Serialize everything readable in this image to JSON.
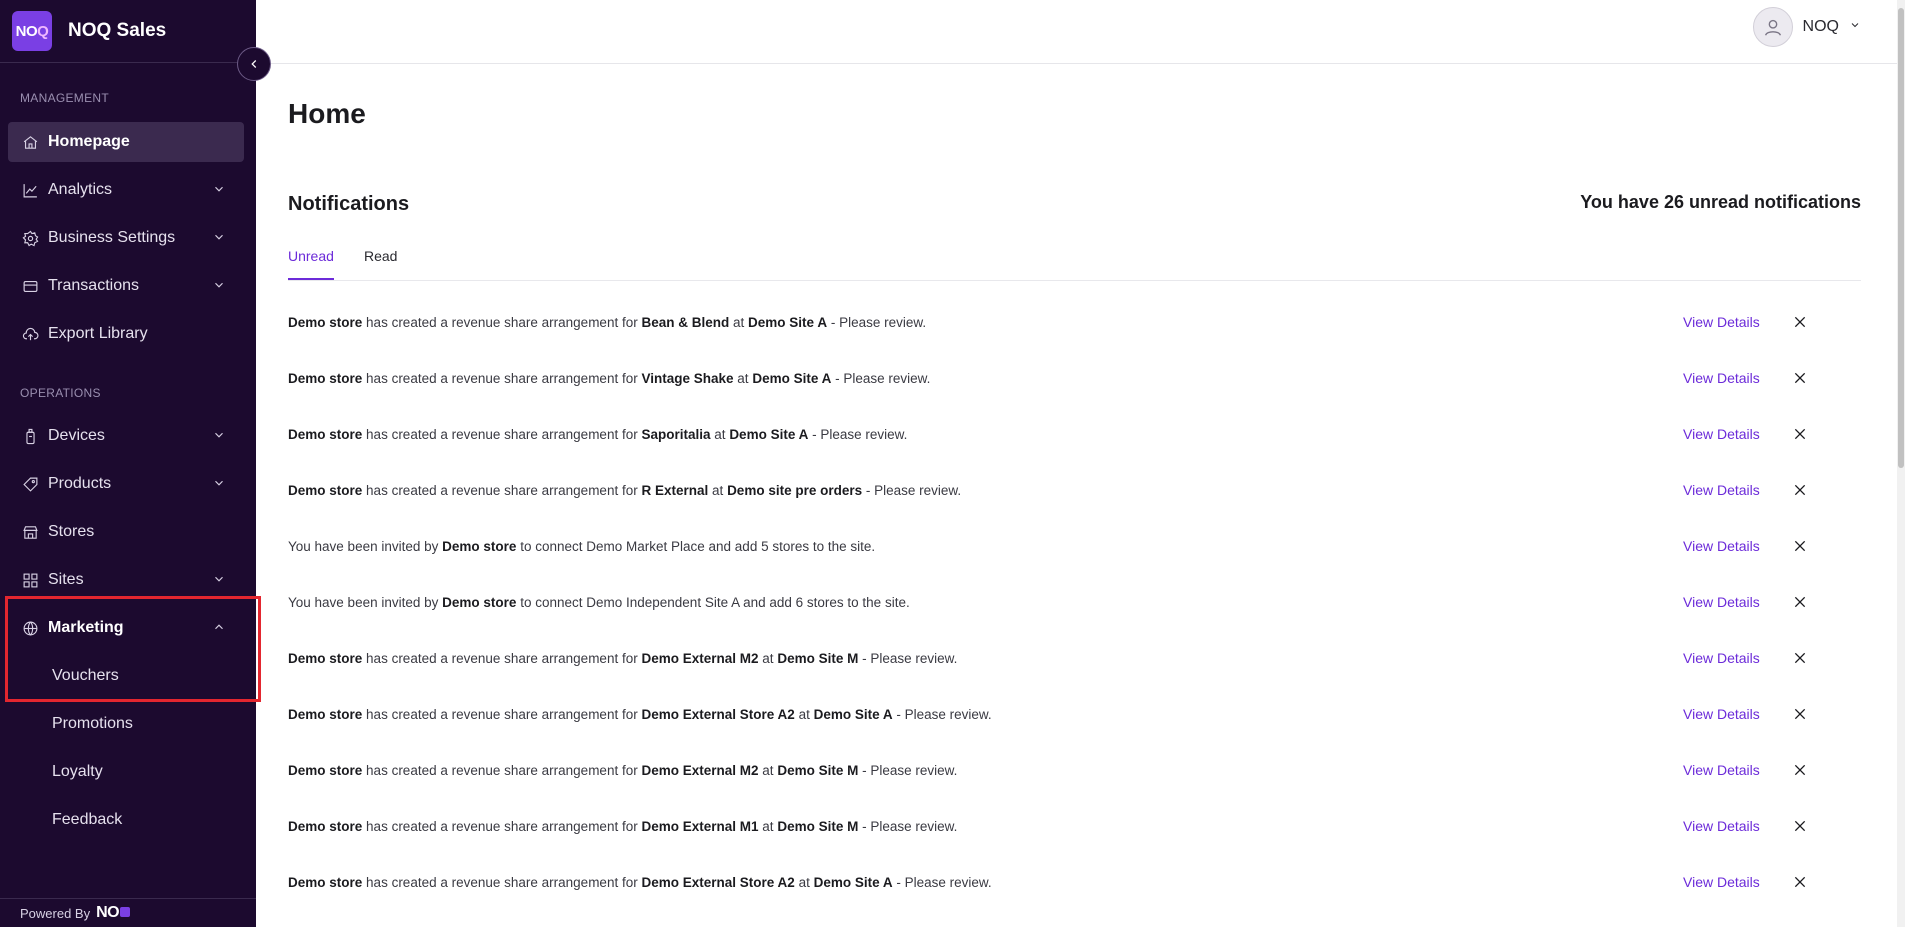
{
  "brand": {
    "name": "NOQ Sales",
    "logo_text_a": "NO",
    "logo_text_b": "Q"
  },
  "sidebar": {
    "management_label": "MANAGEMENT",
    "operations_label": "OPERATIONS",
    "items": [
      {
        "label": "Homepage",
        "icon": "home-icon"
      },
      {
        "label": "Analytics",
        "icon": "chart-icon"
      },
      {
        "label": "Business Settings",
        "icon": "gear-icon"
      },
      {
        "label": "Transactions",
        "icon": "card-icon"
      },
      {
        "label": "Export Library",
        "icon": "cloud-icon"
      },
      {
        "label": "Devices",
        "icon": "device-icon"
      },
      {
        "label": "Products",
        "icon": "tag-icon"
      },
      {
        "label": "Stores",
        "icon": "store-icon"
      },
      {
        "label": "Sites",
        "icon": "grid-icon"
      },
      {
        "label": "Marketing",
        "icon": "globe-icon"
      }
    ],
    "marketing_sub": [
      "Vouchers",
      "Promotions",
      "Loyalty",
      "Feedback"
    ],
    "powered_by": "Powered By",
    "powered_logo": "NO"
  },
  "topbar": {
    "user_name": "NOQ"
  },
  "main": {
    "title": "Home",
    "notifications_title": "Notifications",
    "unread_summary": "You have 26 unread notifications",
    "tabs": [
      "Unread",
      "Read"
    ],
    "view_details_label": "View Details",
    "notifications": [
      {
        "type": "revenue",
        "actor": "Demo store",
        "middle": "has created a revenue share arrangement for",
        "store": "Bean & Blend",
        "at": "at",
        "site": "Demo Site A",
        "suffix": "- Please review."
      },
      {
        "type": "revenue",
        "actor": "Demo store",
        "middle": "has created a revenue share arrangement for",
        "store": "Vintage Shake",
        "at": "at",
        "site": "Demo Site A",
        "suffix": "- Please review."
      },
      {
        "type": "revenue",
        "actor": "Demo store",
        "middle": "has created a revenue share arrangement for",
        "store": "Saporitalia",
        "at": "at",
        "site": "Demo Site A",
        "suffix": "- Please review."
      },
      {
        "type": "revenue",
        "actor": "Demo store",
        "middle": "has created a revenue share arrangement for",
        "store": "R External",
        "at": "at",
        "site": "Demo site pre orders",
        "suffix": "- Please review."
      },
      {
        "type": "invite",
        "prefix": "You have been invited by",
        "actor": "Demo store",
        "suffix": "to connect Demo Market Place and add 5 stores to the site."
      },
      {
        "type": "invite",
        "prefix": "You have been invited by",
        "actor": "Demo store",
        "suffix": "to connect Demo Independent Site A and add 6 stores to the site."
      },
      {
        "type": "revenue",
        "actor": "Demo store",
        "middle": "has created a revenue share arrangement for",
        "store": "Demo External M2",
        "at": "at",
        "site": "Demo Site M",
        "suffix": "- Please review."
      },
      {
        "type": "revenue",
        "actor": "Demo store",
        "middle": "has created a revenue share arrangement for",
        "store": "Demo External Store A2",
        "at": "at",
        "site": "Demo Site A",
        "suffix": "- Please review."
      },
      {
        "type": "revenue",
        "actor": "Demo store",
        "middle": "has created a revenue share arrangement for",
        "store": "Demo External M2",
        "at": "at",
        "site": "Demo Site M",
        "suffix": "- Please review."
      },
      {
        "type": "revenue",
        "actor": "Demo store",
        "middle": "has created a revenue share arrangement for",
        "store": "Demo External M1",
        "at": "at",
        "site": "Demo Site M",
        "suffix": "- Please review."
      },
      {
        "type": "revenue",
        "actor": "Demo store",
        "middle": "has created a revenue share arrangement for",
        "store": "Demo External Store A2",
        "at": "at",
        "site": "Demo Site A",
        "suffix": "- Please review."
      }
    ]
  },
  "colors": {
    "sidebar_bg": "#1c0a2f",
    "accent": "#6c2bd9",
    "highlight": "#e3262f"
  }
}
